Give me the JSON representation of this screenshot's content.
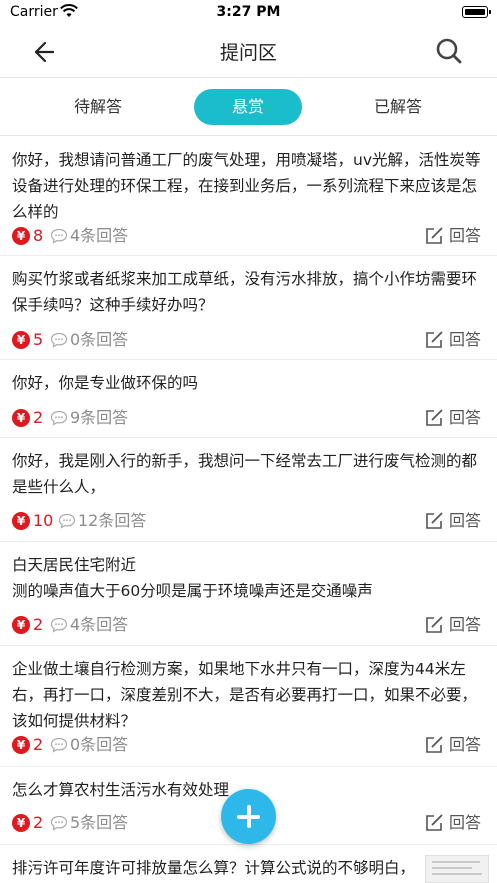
{
  "status": {
    "carrier": "Carrier",
    "time": "3:27 PM"
  },
  "nav": {
    "title": "提问区",
    "back_icon": "back-arrow-icon",
    "search_icon": "search-icon"
  },
  "tabs": [
    {
      "label": "待解答",
      "active": false
    },
    {
      "label": "悬赏",
      "active": true
    },
    {
      "label": "已解答",
      "active": false
    }
  ],
  "answer_label": "回答",
  "colors": {
    "accent": "#1bbccc",
    "reward": "#e0191e",
    "fab": "#2eb8ea"
  },
  "questions": [
    {
      "text": "你好，我想请问普通工厂的废气处理，用喷凝塔，uv光解，活性炭等设备进行处理的环保工程，在接到业务后，一系列流程下来应该是怎么样的",
      "reward": "8",
      "answers": "4条回答"
    },
    {
      "text": "购买竹浆或者纸浆来加工成草纸，没有污水排放，搞个小作坊需要环保手续吗？这种手续好办吗？",
      "reward": "5",
      "answers": "0条回答"
    },
    {
      "text": "你好，你是专业做环保的吗",
      "reward": "2",
      "answers": "9条回答"
    },
    {
      "text": "你好，我是刚入行的新手，我想问一下经常去工厂进行废气检测的都是些什么人，",
      "reward": "10",
      "answers": "12条回答"
    },
    {
      "text": "白天居民住宅附近\n测的噪声值大于60分呗是属于环境噪声还是交通噪声",
      "reward": "2",
      "answers": "4条回答"
    },
    {
      "text": "企业做土壤自行检测方案，如果地下水井只有一口，深度为44米左右，再打一口，深度差别不大，是否有必要再打一口，如果不必要，该如何提供材料？",
      "reward": "2",
      "answers": "0条回答"
    },
    {
      "text": "怎么才算农村生活污水有效处理",
      "reward": "2",
      "answers": "5条回答"
    },
    {
      "text": "排污许可年度许可排放量怎么算？计算公式说的不够明白，谁能用工类无再给我解释一下，",
      "reward": "",
      "answers": ""
    }
  ]
}
